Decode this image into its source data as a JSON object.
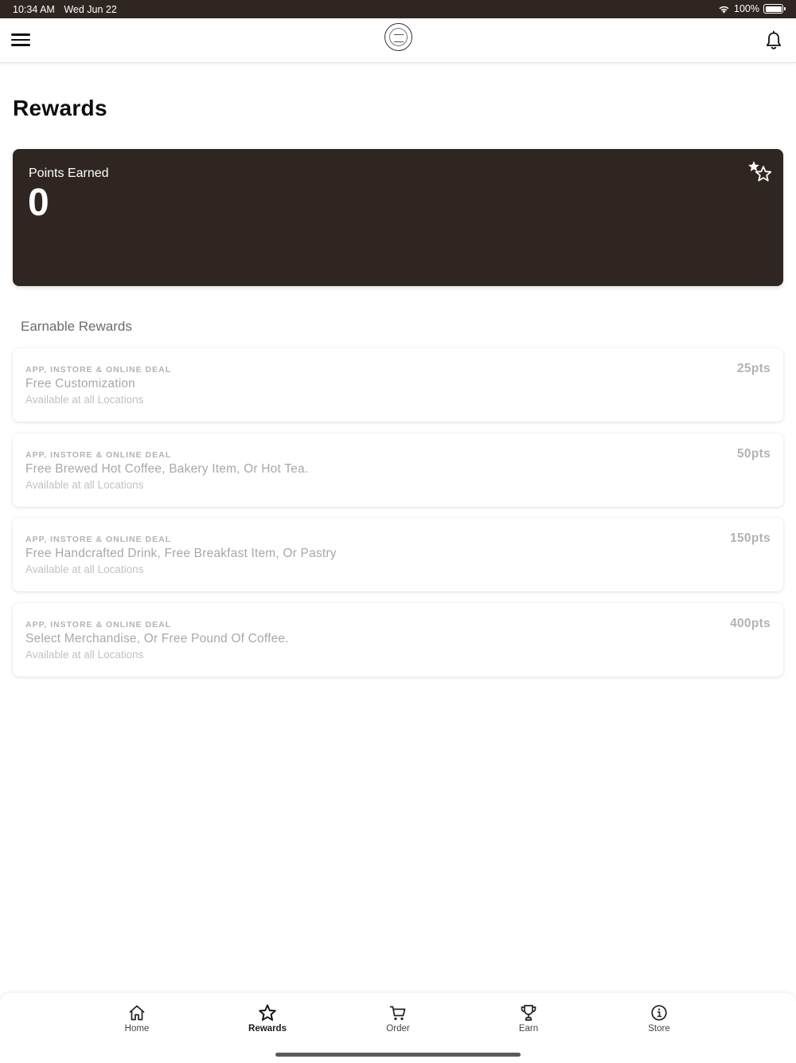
{
  "status_bar": {
    "time": "10:34 AM",
    "date": "Wed Jun 22",
    "battery": "100%"
  },
  "header": {
    "menu_icon": "hamburger-menu-icon",
    "logo": "brand-logo",
    "bell_icon": "bell-icon"
  },
  "page": {
    "title": "Rewards"
  },
  "points_card": {
    "label": "Points Earned",
    "value": "0",
    "icon": "stars-icon",
    "background": "#2f2622"
  },
  "earnable": {
    "title": "Earnable Rewards",
    "items": [
      {
        "tag": "APP, INSTORE & ONLINE DEAL",
        "title": "Free Customization",
        "subtitle": "Available at all Locations",
        "points": "25pts"
      },
      {
        "tag": "APP, INSTORE & ONLINE DEAL",
        "title": "Free Brewed Hot Coffee, Bakery Item, Or Hot Tea.",
        "subtitle": "Available at all Locations",
        "points": "50pts"
      },
      {
        "tag": "APP, INSTORE & ONLINE DEAL",
        "title": "Free Handcrafted Drink, Free Breakfast Item, Or Pastry",
        "subtitle": "Available at all Locations",
        "points": "150pts"
      },
      {
        "tag": "APP, INSTORE & ONLINE DEAL",
        "title": "Select Merchandise, Or Free Pound Of Coffee.",
        "subtitle": "Available at all Locations",
        "points": "400pts"
      }
    ]
  },
  "tabs": [
    {
      "label": "Home",
      "icon": "home-icon"
    },
    {
      "label": "Rewards",
      "icon": "star-icon",
      "active": true
    },
    {
      "label": "Order",
      "icon": "cart-icon"
    },
    {
      "label": "Earn",
      "icon": "trophy-icon"
    },
    {
      "label": "Store",
      "icon": "info-icon"
    }
  ]
}
